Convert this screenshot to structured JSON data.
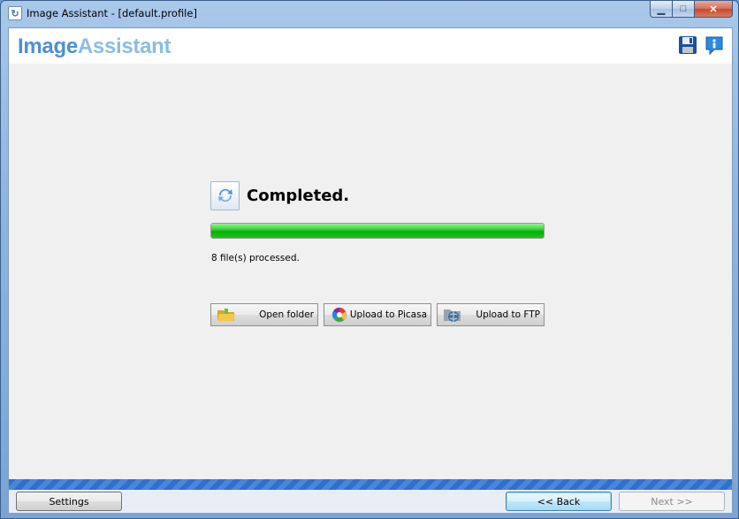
{
  "window": {
    "title": "Image Assistant - [default.profile]",
    "buttons": {
      "minimize": "▁",
      "maximize": "□",
      "close": "✕"
    }
  },
  "header": {
    "brand_part1": "Image",
    "brand_part2": "Assistant",
    "icons": [
      "save-icon",
      "info-icon"
    ]
  },
  "status": {
    "title": "Completed.",
    "progress_fraction": 1.0,
    "processed_text": "8 file(s) processed."
  },
  "actions": [
    {
      "label": "Open folder",
      "icon": "folder-icon"
    },
    {
      "label": "Upload to Picasa",
      "icon": "picasa-icon"
    },
    {
      "label": "Upload to FTP",
      "icon": "ftp-icon"
    }
  ],
  "footer": {
    "settings_label": "Settings",
    "back_label": "<< Back",
    "next_label": "Next >>"
  },
  "colors": {
    "brand_dark": "#4d8fd6",
    "brand_light": "#8ebbe8",
    "progress_green": "#06b006",
    "stripe_blue": "#2f6fd0"
  }
}
